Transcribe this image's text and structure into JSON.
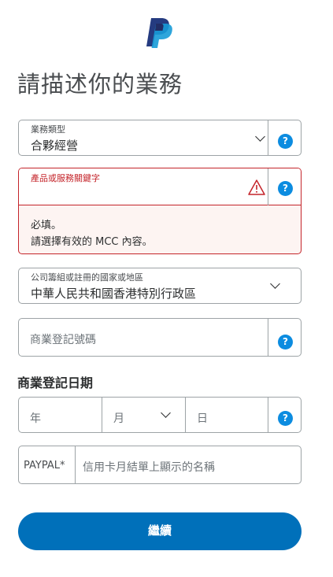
{
  "page": {
    "title": "請描述你的業務"
  },
  "business_type": {
    "label": "業務類型",
    "value": "合夥經營",
    "help": "?"
  },
  "product_keyword": {
    "label": "產品或服務關鍵字",
    "help": "?",
    "errors": [
      "必填。",
      "請選擇有效的 MCC 內容。"
    ]
  },
  "country": {
    "label": "公司籌組或註冊的國家或地區",
    "value": "中華人民共和國香港特別行政區"
  },
  "registration_number": {
    "placeholder": "商業登記號碼",
    "help": "?"
  },
  "registration_date": {
    "title": "商業登記日期",
    "year_placeholder": "年",
    "month_placeholder": "月",
    "day_placeholder": "日",
    "help": "?"
  },
  "card_statement": {
    "prefix": "PAYPAL*",
    "placeholder": "信用卡月結單上顯示的名稱"
  },
  "actions": {
    "continue_label": "繼續"
  },
  "colors": {
    "brand_blue": "#0070ba",
    "help_blue": "#0c8ce0",
    "error_red": "#c4242a",
    "logo_dark": "#253b80",
    "logo_light": "#179bd7"
  }
}
